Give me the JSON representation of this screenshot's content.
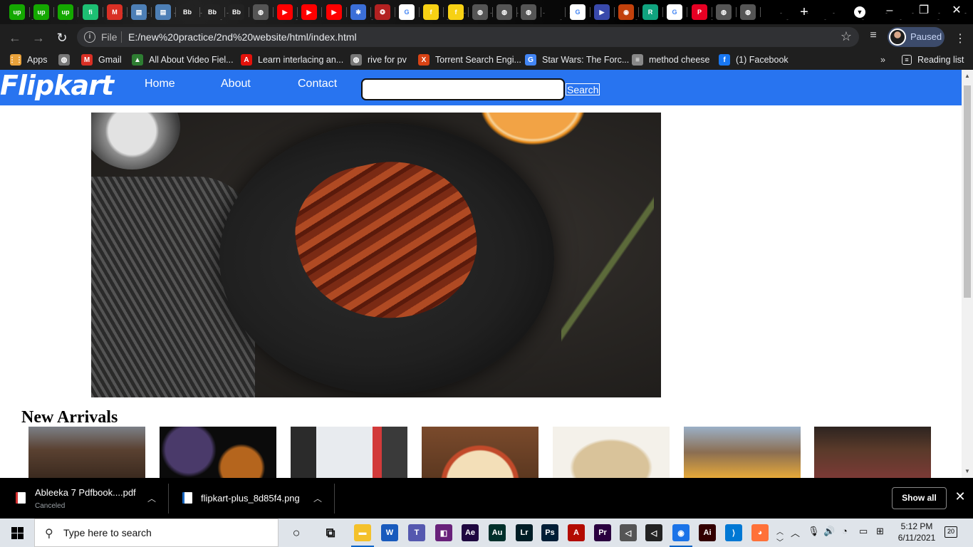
{
  "browser": {
    "address": {
      "scheme": "File",
      "url": "E:/new%20practice/2nd%20website/html/index.html"
    },
    "profile": {
      "label": "Paused"
    },
    "tabs": [
      {
        "icon": "upwork-icon",
        "glyph": "up",
        "color": "#14a800"
      },
      {
        "icon": "upwork-icon",
        "glyph": "up",
        "color": "#14a800"
      },
      {
        "icon": "upwork-icon",
        "glyph": "up",
        "color": "#14a800"
      },
      {
        "icon": "fiverr-icon",
        "glyph": "fi",
        "color": "#1dbf73"
      },
      {
        "icon": "gmail-icon",
        "glyph": "M",
        "color": "#d93025"
      },
      {
        "icon": "image-icon",
        "glyph": "▤",
        "color": "#4d7fb6"
      },
      {
        "icon": "image-icon",
        "glyph": "▤",
        "color": "#4d7fb6"
      },
      {
        "icon": "bb-icon",
        "glyph": "Bb",
        "color": "#222"
      },
      {
        "icon": "bb-icon",
        "glyph": "Bb",
        "color": "#222"
      },
      {
        "icon": "bb-icon",
        "glyph": "Bb",
        "color": "#222"
      },
      {
        "icon": "globe-icon",
        "glyph": "◍",
        "color": "#555"
      },
      {
        "icon": "youtube-icon",
        "glyph": "▶",
        "color": "#ff0000"
      },
      {
        "icon": "youtube-icon",
        "glyph": "▶",
        "color": "#ff0000"
      },
      {
        "icon": "youtube-icon",
        "glyph": "▶",
        "color": "#ff0000"
      },
      {
        "icon": "colorful-icon",
        "glyph": "✱",
        "color": "#3b6fd8"
      },
      {
        "icon": "reddish-icon",
        "glyph": "❂",
        "color": "#b32121"
      },
      {
        "icon": "google-icon",
        "glyph": "G",
        "color": "#ffffff"
      },
      {
        "icon": "flipkart-icon",
        "glyph": "f",
        "color": "#f7d114"
      },
      {
        "icon": "flipkart-icon",
        "glyph": "f",
        "color": "#f7d114"
      },
      {
        "icon": "globe-icon",
        "glyph": "◍",
        "color": "#555"
      },
      {
        "icon": "globe-icon",
        "glyph": "◍",
        "color": "#555"
      },
      {
        "icon": "globe-icon",
        "glyph": "◍",
        "color": "#555"
      },
      {
        "icon": "blank-icon",
        "glyph": "",
        "color": "transparent"
      },
      {
        "icon": "google-icon",
        "glyph": "G",
        "color": "#ffffff"
      },
      {
        "icon": "arrow-icon",
        "glyph": "▶",
        "color": "#3949ab"
      },
      {
        "icon": "eye-icon",
        "glyph": "◉",
        "color": "#c2410c"
      },
      {
        "icon": "r-icon",
        "glyph": "R",
        "color": "#10a37f"
      },
      {
        "icon": "google-icon",
        "glyph": "G",
        "color": "#ffffff"
      },
      {
        "icon": "pinterest-icon",
        "glyph": "P",
        "color": "#e60023"
      },
      {
        "icon": "globe-icon",
        "glyph": "◍",
        "color": "#555"
      },
      {
        "icon": "globe-icon",
        "glyph": "◍",
        "color": "#555"
      }
    ],
    "bookmarks": [
      {
        "label": "Apps",
        "icon": "apps-grid-icon",
        "glyph": "⋮⋮",
        "color": "#e8a13a"
      },
      {
        "label": "",
        "icon": "globe-icon",
        "glyph": "◍",
        "color": "#777"
      },
      {
        "label": "Gmail",
        "icon": "gmail-icon",
        "glyph": "M",
        "color": "#d93025"
      },
      {
        "label": "All About Video Fiel...",
        "icon": "video-icon",
        "glyph": "▲",
        "color": "#2e7d32"
      },
      {
        "label": "Learn interlacing an...",
        "icon": "adobe-icon",
        "glyph": "A",
        "color": "#e3120b"
      },
      {
        "label": "rive for pv",
        "icon": "globe-icon",
        "glyph": "◍",
        "color": "#777"
      },
      {
        "label": "Torrent Search Engi...",
        "icon": "x-icon",
        "glyph": "X",
        "color": "#d84315"
      },
      {
        "label": "Star Wars: The Forc...",
        "icon": "google-icon",
        "glyph": "G",
        "color": "#4285f4"
      },
      {
        "label": "method cheese",
        "icon": "doc-icon",
        "glyph": "≡",
        "color": "#888"
      },
      {
        "label": "(1) Facebook",
        "icon": "facebook-icon",
        "glyph": "f",
        "color": "#1877f2"
      }
    ],
    "reading_list": "Reading list"
  },
  "site": {
    "logo": "Flipkart",
    "nav": [
      "Home",
      "About",
      "Contact"
    ],
    "search": {
      "value": "",
      "button": "Search"
    },
    "hero_image": "bacon-burger-photo",
    "new_arrivals": {
      "title": "New Arrivals",
      "items": [
        {
          "image": "brownies-photo"
        },
        {
          "image": "cocktail-photo"
        },
        {
          "image": "chef-photo"
        },
        {
          "image": "pizza-photo"
        },
        {
          "image": "pasta-photo"
        },
        {
          "image": "burger-photo"
        },
        {
          "image": "restaurant-photo"
        }
      ]
    },
    "colors": {
      "nav_bg": "#2874f0"
    }
  },
  "downloads": {
    "items": [
      {
        "name": "Ableeka 7 Pdfbook....pdf",
        "status": "Canceled",
        "icon": "pdf-icon"
      },
      {
        "name": "flipkart-plus_8d85f4.png",
        "status": "",
        "icon": "image-file-icon"
      }
    ],
    "show_all": "Show all"
  },
  "taskbar": {
    "search_placeholder": "Type here to search",
    "apps": [
      {
        "icon": "cortana-icon",
        "glyph": "○",
        "color": "transparent"
      },
      {
        "icon": "task-view-icon",
        "glyph": "⧉",
        "color": "transparent"
      },
      {
        "icon": "file-explorer-icon",
        "glyph": "▬",
        "color": "#f4c12b"
      },
      {
        "icon": "word-icon",
        "glyph": "W",
        "color": "#185abd"
      },
      {
        "icon": "teams-icon",
        "glyph": "T",
        "color": "#5558af"
      },
      {
        "icon": "visual-studio-icon",
        "glyph": "◧",
        "color": "#68217a"
      },
      {
        "icon": "after-effects-icon",
        "glyph": "Ae",
        "color": "#1f0740"
      },
      {
        "icon": "audition-icon",
        "glyph": "Au",
        "color": "#00302b"
      },
      {
        "icon": "lightroom-icon",
        "glyph": "Lr",
        "color": "#001d26"
      },
      {
        "icon": "photoshop-icon",
        "glyph": "Ps",
        "color": "#001e36"
      },
      {
        "icon": "acrobat-icon",
        "glyph": "A",
        "color": "#b30b00"
      },
      {
        "icon": "premiere-icon",
        "glyph": "Pr",
        "color": "#2a003f"
      },
      {
        "icon": "unity-icon",
        "glyph": "◁",
        "color": "#555"
      },
      {
        "icon": "unity-icon",
        "glyph": "◁",
        "color": "#222"
      },
      {
        "icon": "chrome-icon",
        "glyph": "◉",
        "color": "#1a73e8"
      },
      {
        "icon": "illustrator-icon",
        "glyph": "Ai",
        "color": "#330000"
      },
      {
        "icon": "vscode-icon",
        "glyph": "⟩",
        "color": "#0078d4"
      },
      {
        "icon": "firefox-icon",
        "glyph": "◕",
        "color": "#ff7139"
      }
    ],
    "time": "5:12 PM",
    "date": "6/11/2021",
    "notifications": "20"
  }
}
